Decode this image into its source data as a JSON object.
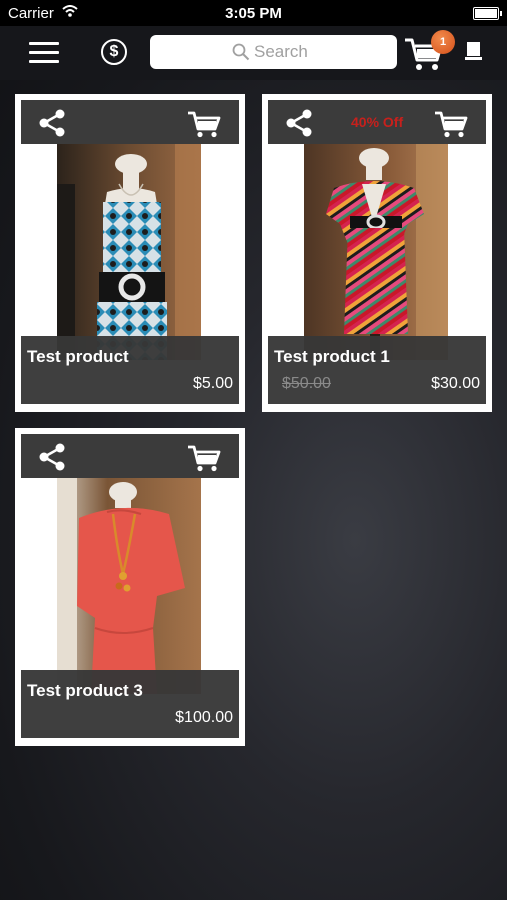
{
  "status_bar": {
    "carrier": "Carrier",
    "time": "3:05 PM"
  },
  "nav": {
    "search_placeholder": "Search",
    "cart_count": "1",
    "icons": [
      "menu-icon",
      "dollar-icon",
      "search-icon",
      "cart-icon",
      "book-icon"
    ]
  },
  "products": [
    {
      "name": "Test product",
      "price": "$5.00",
      "old_price": "",
      "discount": ""
    },
    {
      "name": "Test product 1",
      "price": "$30.00",
      "old_price": "$50.00",
      "discount": "40% Off"
    },
    {
      "name": "Test product 3",
      "price": "$100.00",
      "old_price": "",
      "discount": ""
    }
  ],
  "colors": {
    "discount": "#c8201c",
    "badge": "#e2662a",
    "card_bar": "#3b3b3b"
  }
}
